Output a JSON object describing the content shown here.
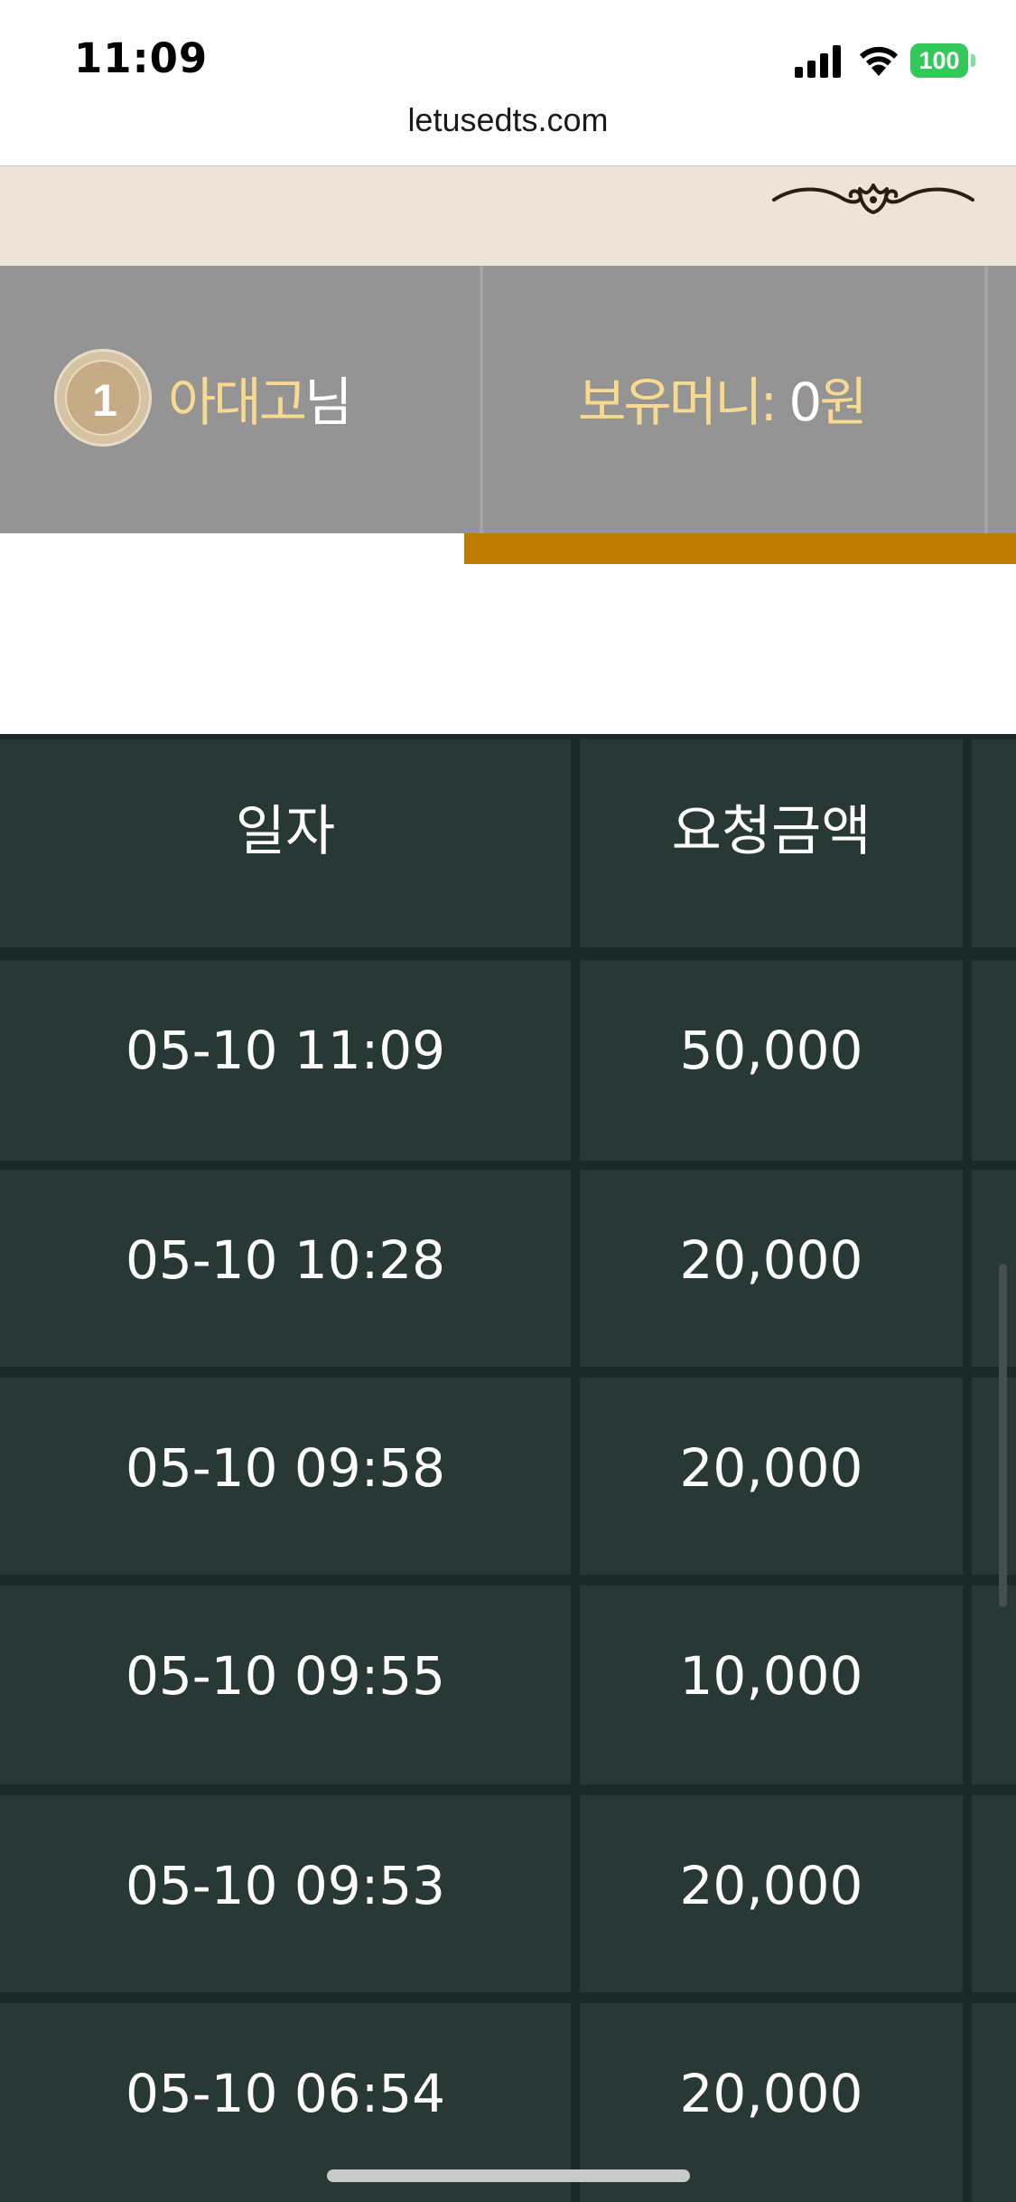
{
  "status_bar": {
    "time": "11:09",
    "battery": "100",
    "icons": [
      "signal-icon",
      "wifi-icon",
      "battery-icon"
    ]
  },
  "browser": {
    "url": "letusedts.com"
  },
  "header": {
    "ornament_icon": "flourish-ornament-icon"
  },
  "user": {
    "level": "1",
    "name": "아대고",
    "name_suffix": "님",
    "balance_label": "보유머니: ",
    "balance_value": "0",
    "balance_unit": "원"
  },
  "table": {
    "columns": [
      "일자",
      "요청금액"
    ],
    "rows": [
      {
        "date": "05-10 11:09",
        "amount": "50,000"
      },
      {
        "date": "05-10 10:28",
        "amount": "20,000"
      },
      {
        "date": "05-10 09:58",
        "amount": "20,000"
      },
      {
        "date": "05-10 09:55",
        "amount": "10,000"
      },
      {
        "date": "05-10 09:53",
        "amount": "20,000"
      },
      {
        "date": "05-10 06:54",
        "amount": "20,000"
      }
    ]
  },
  "colors": {
    "accent": "#bf7a00",
    "gold_text": "#f7d98f",
    "table_bg": "#273835",
    "banner_bg": "#ebe4d7",
    "user_bar_bg": "#949494"
  }
}
